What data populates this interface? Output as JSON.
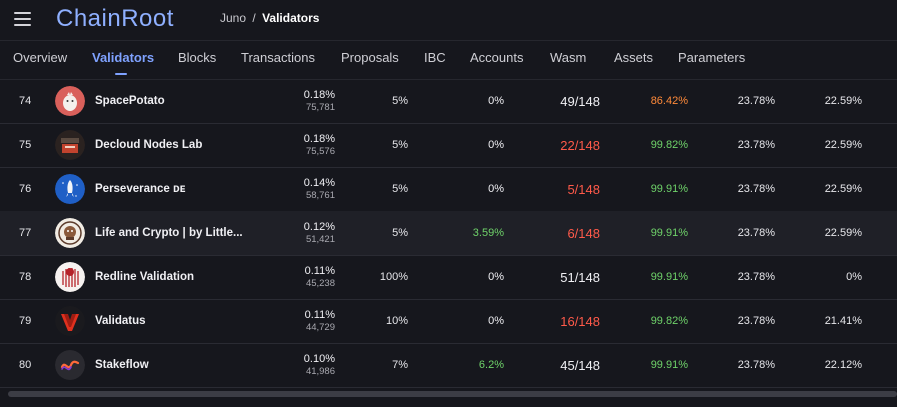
{
  "app": {
    "title": "ChainRoot"
  },
  "breadcrumb": {
    "parent": "Juno",
    "separator": "/",
    "current": "Validators"
  },
  "tabs": [
    {
      "label": "Overview"
    },
    {
      "label": "Validators"
    },
    {
      "label": "Blocks"
    },
    {
      "label": "Transactions"
    },
    {
      "label": "Proposals"
    },
    {
      "label": "IBC"
    },
    {
      "label": "Accounts"
    },
    {
      "label": "Wasm"
    },
    {
      "label": "Assets"
    },
    {
      "label": "Parameters"
    }
  ],
  "active_tab": "Validators",
  "colors": {
    "accent": "#7fa2ff",
    "green": "#6fd36a",
    "red": "#ff5a4a",
    "orange": "#ff8a3a"
  },
  "rows": [
    {
      "rank": "74",
      "name": "SpacePotato",
      "voting_power_pct": "0.18%",
      "voting_power": "75,781",
      "commission": "5%",
      "change": "0%",
      "missed": "49/148",
      "uptime": "86.42%",
      "gov_a": "23.78%",
      "gov_b": "22.59%",
      "avatar": "potato-avatar"
    },
    {
      "rank": "75",
      "name": "Decloud Nodes Lab",
      "voting_power_pct": "0.18%",
      "voting_power": "75,576",
      "commission": "5%",
      "change": "0%",
      "missed": "22/148",
      "uptime": "99.82%",
      "gov_a": "23.78%",
      "gov_b": "22.59%",
      "avatar": "decloud-avatar"
    },
    {
      "rank": "76",
      "name": "Perseverance ᴅᴇ",
      "voting_power_pct": "0.14%",
      "voting_power": "58,761",
      "commission": "5%",
      "change": "0%",
      "missed": "5/148",
      "uptime": "99.91%",
      "gov_a": "23.78%",
      "gov_b": "22.59%",
      "avatar": "rocket-avatar"
    },
    {
      "rank": "77",
      "name": "Life and Crypto | by Little...",
      "voting_power_pct": "0.12%",
      "voting_power": "51,421",
      "commission": "5%",
      "change": "3.59%",
      "missed": "6/148",
      "uptime": "99.91%",
      "gov_a": "23.78%",
      "gov_b": "22.59%",
      "avatar": "lifecrypto-avatar"
    },
    {
      "rank": "78",
      "name": "Redline Validation",
      "voting_power_pct": "0.11%",
      "voting_power": "45,238",
      "commission": "100%",
      "change": "0%",
      "missed": "51/148",
      "uptime": "99.91%",
      "gov_a": "23.78%",
      "gov_b": "0%",
      "avatar": "redline-avatar"
    },
    {
      "rank": "79",
      "name": "Validatus",
      "voting_power_pct": "0.11%",
      "voting_power": "44,729",
      "commission": "10%",
      "change": "0%",
      "missed": "16/148",
      "uptime": "99.82%",
      "gov_a": "23.78%",
      "gov_b": "21.41%",
      "avatar": "validatus-avatar"
    },
    {
      "rank": "80",
      "name": "Stakeflow",
      "voting_power_pct": "0.10%",
      "voting_power": "41,986",
      "commission": "7%",
      "change": "6.2%",
      "missed": "45/148",
      "uptime": "99.91%",
      "gov_a": "23.78%",
      "gov_b": "22.12%",
      "avatar": "stakeflow-avatar"
    }
  ]
}
